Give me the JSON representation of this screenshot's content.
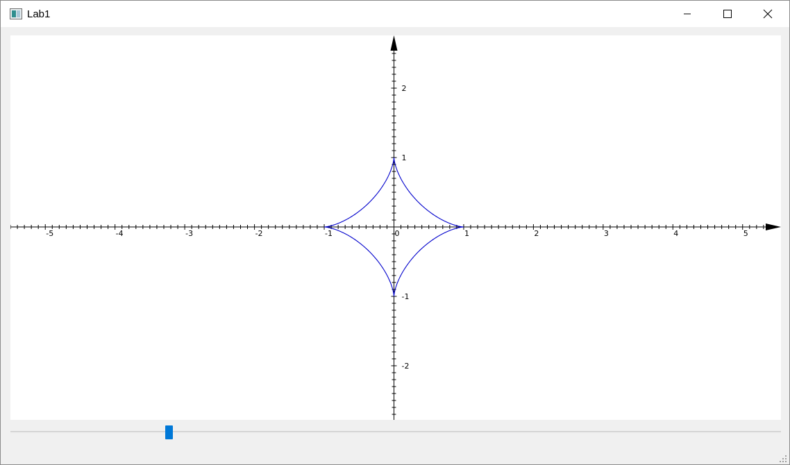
{
  "window": {
    "title": "Lab1",
    "app_icon": "window-app-icon",
    "controls": {
      "minimize_icon": "minimize-icon",
      "maximize_icon": "maximize-icon",
      "close_icon": "close-icon"
    }
  },
  "chart_data": {
    "type": "line",
    "title": "",
    "xlabel": "",
    "ylabel": "",
    "xlim": [
      -5.5,
      5.55
    ],
    "ylim": [
      -2.78,
      2.76
    ],
    "x_ticks": [
      -5,
      -4,
      -3,
      -2,
      -1,
      0,
      1,
      2,
      3,
      4,
      5
    ],
    "y_ticks": [
      -2,
      -1,
      1,
      2
    ],
    "x_tick_labels": [
      "-5",
      "-4",
      "-3",
      "-2",
      "-1",
      "0",
      "1",
      "2",
      "3",
      "4",
      "5"
    ],
    "y_tick_labels": [
      "-2",
      "-1",
      "1",
      "2"
    ],
    "minor_tick_step": 0.1,
    "grid": false,
    "axes_arrows": true,
    "series": [
      {
        "curve": "astroid",
        "equation": "x = cos^3 t, y = sin^3 t",
        "t_range": [
          0,
          6.2832
        ],
        "points": [
          [
            1.0,
            0.0
          ],
          [
            0.92,
            0.003
          ],
          [
            0.71,
            0.04
          ],
          [
            0.5,
            0.125
          ],
          [
            0.35,
            0.21
          ],
          [
            0.21,
            0.35
          ],
          [
            0.125,
            0.5
          ],
          [
            0.04,
            0.71
          ],
          [
            0.003,
            0.92
          ],
          [
            0.0,
            1.0
          ],
          [
            -0.003,
            0.92
          ],
          [
            -0.04,
            0.71
          ],
          [
            -0.125,
            0.5
          ],
          [
            -0.21,
            0.35
          ],
          [
            -0.35,
            0.21
          ],
          [
            -0.5,
            0.125
          ],
          [
            -0.71,
            0.04
          ],
          [
            -0.92,
            0.003
          ],
          [
            -1.0,
            0.0
          ],
          [
            -0.92,
            -0.003
          ],
          [
            -0.71,
            -0.04
          ],
          [
            -0.5,
            -0.125
          ],
          [
            -0.35,
            -0.21
          ],
          [
            -0.21,
            -0.35
          ],
          [
            -0.125,
            -0.5
          ],
          [
            -0.04,
            -0.71
          ],
          [
            -0.003,
            -0.92
          ],
          [
            0.0,
            -1.0
          ],
          [
            0.003,
            -0.92
          ],
          [
            0.04,
            -0.71
          ],
          [
            0.125,
            -0.5
          ],
          [
            0.21,
            -0.35
          ],
          [
            0.35,
            -0.21
          ],
          [
            0.5,
            -0.125
          ],
          [
            0.71,
            -0.04
          ],
          [
            0.92,
            -0.003
          ],
          [
            1.0,
            0.0
          ]
        ],
        "color": "#0000cc"
      }
    ],
    "axis_color": "#000000"
  },
  "slider": {
    "value_fraction": 0.203,
    "accent_color": "#0078d7"
  },
  "size_grip_icon": "size-grip-icon"
}
